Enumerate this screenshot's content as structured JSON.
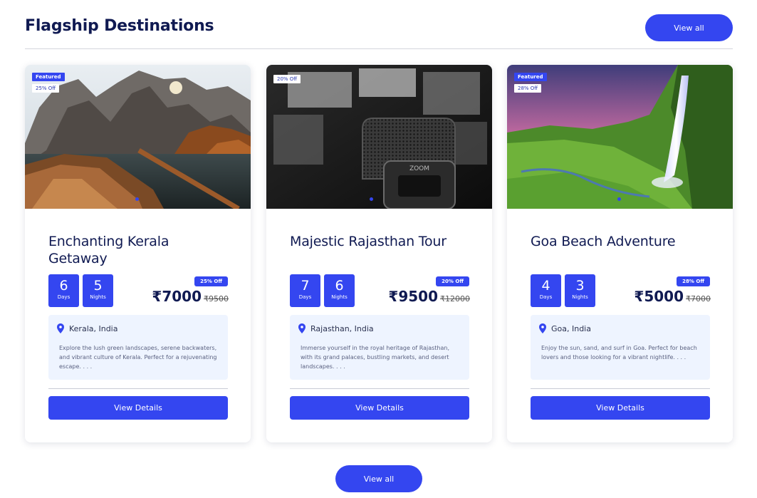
{
  "section": {
    "title": "Flagship Destinations",
    "view_all_top": "View all",
    "view_all_bottom": "View all"
  },
  "colors": {
    "accent": "#3446f0",
    "heading": "#101a52",
    "info_bg": "#eef4ff"
  },
  "cards": [
    {
      "featured": "Featured",
      "image_badge": "25% Off",
      "image": "mountain-lake-boat",
      "title": "Enchanting Kerala Getaway",
      "days": "6",
      "days_label": "Days",
      "nights": "5",
      "nights_label": "Nights",
      "discount": "25% Off",
      "price": "₹7000",
      "old_price": "₹9500",
      "location": "Kerala, India",
      "description": "Explore the lush green landscapes, serene backwaters, and vibrant culture of Kerala. Perfect for a rejuvenating escape. . . .",
      "button": "View Details"
    },
    {
      "image_badge": "20% Off",
      "image": "microphone-recorder",
      "title": "Majestic Rajasthan Tour",
      "days": "7",
      "days_label": "Days",
      "nights": "6",
      "nights_label": "Nights",
      "discount": "20% Off",
      "price": "₹9500",
      "old_price": "₹12000",
      "location": "Rajasthan, India",
      "description": "Immerse yourself in the royal heritage of Rajasthan, with its grand palaces, bustling markets, and desert landscapes. . . .",
      "button": "View Details"
    },
    {
      "featured": "Featured",
      "image_badge": "28% Off",
      "image": "waterfall-green-valley",
      "title": "Goa Beach Adventure",
      "days": "4",
      "days_label": "Days",
      "nights": "3",
      "nights_label": "Nights",
      "discount": "28% Off",
      "price": "₹5000",
      "old_price": "₹7000",
      "location": "Goa, India",
      "description": "Enjoy the sun, sand, and surf in Goa. Perfect for beach lovers and those looking for a vibrant nightlife. . . .",
      "button": "View Details"
    }
  ]
}
